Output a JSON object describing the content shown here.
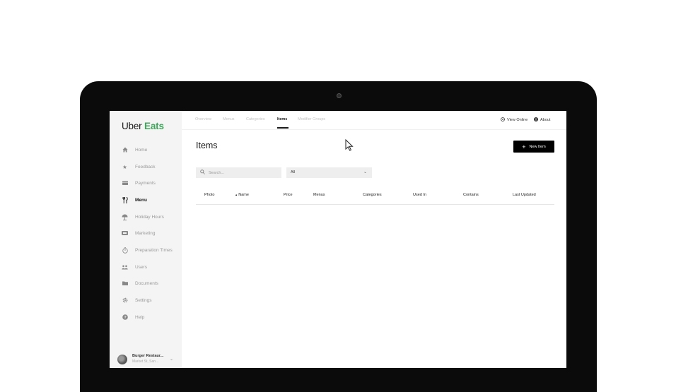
{
  "brand": {
    "uber": "Uber",
    "eats": "Eats"
  },
  "sidebar": {
    "items": [
      {
        "label": "Home",
        "icon": "home-icon"
      },
      {
        "label": "Feedback",
        "icon": "star-icon"
      },
      {
        "label": "Payments",
        "icon": "card-icon"
      },
      {
        "label": "Menu",
        "icon": "utensils-icon"
      },
      {
        "label": "Holiday Hours",
        "icon": "umbrella-icon"
      },
      {
        "label": "Marketing",
        "icon": "ad-icon"
      },
      {
        "label": "Preparation Times",
        "icon": "timer-icon"
      },
      {
        "label": "Users",
        "icon": "users-icon"
      },
      {
        "label": "Documents",
        "icon": "folder-icon"
      },
      {
        "label": "Settings",
        "icon": "gear-icon"
      },
      {
        "label": "Help",
        "icon": "help-icon"
      }
    ],
    "active": "Menu",
    "account": {
      "name": "Burger Restaur...",
      "address": "Market St, San..."
    }
  },
  "tabs": [
    {
      "label": "Overview"
    },
    {
      "label": "Menus"
    },
    {
      "label": "Categories"
    },
    {
      "label": "Items"
    },
    {
      "label": "Modifier Groups"
    }
  ],
  "active_tab": "Items",
  "header": {
    "view_online": "View Online",
    "about": "About"
  },
  "page": {
    "title": "Items",
    "new_button": "New Item"
  },
  "filters": {
    "search_placeholder": "Search...",
    "select_value": "All"
  },
  "table": {
    "columns": [
      "Photo",
      "Name",
      "Price",
      "Menus",
      "Categories",
      "Used In",
      "Contains",
      "Last Updated"
    ],
    "sort_marker": "▴",
    "rows": []
  }
}
